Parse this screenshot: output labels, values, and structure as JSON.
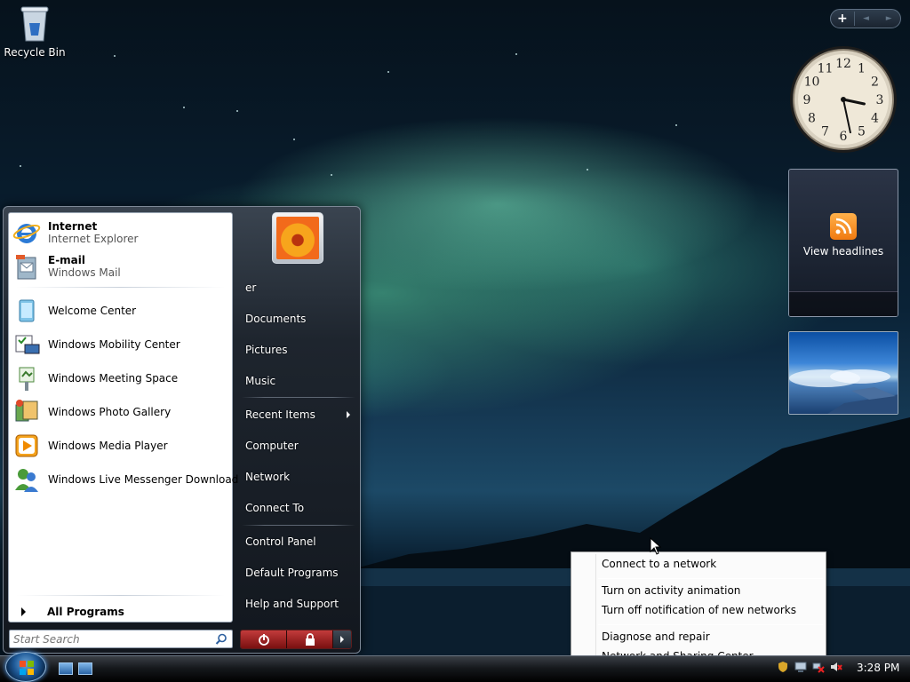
{
  "desktop": {
    "recycle_bin_label": "Recycle Bin"
  },
  "gadgets": {
    "controls": {
      "add": "+",
      "prev": "◄",
      "next": "►"
    },
    "clock": {
      "numbers": [
        "12",
        "1",
        "2",
        "3",
        "4",
        "5",
        "6",
        "7",
        "8",
        "9",
        "10",
        "11"
      ],
      "hour": 3.4,
      "minute": 28
    },
    "feed": {
      "label": "View headlines"
    }
  },
  "start_menu": {
    "pinned": [
      {
        "title": "Internet",
        "subtitle": "Internet Explorer",
        "icon": "internet-explorer-icon"
      },
      {
        "title": "E-mail",
        "subtitle": "Windows Mail",
        "icon": "windows-mail-icon"
      }
    ],
    "recent_programs": [
      {
        "label": "Welcome Center",
        "icon": "welcome-center-icon"
      },
      {
        "label": "Windows Mobility Center",
        "icon": "mobility-center-icon"
      },
      {
        "label": "Windows Meeting Space",
        "icon": "meeting-space-icon"
      },
      {
        "label": "Windows Photo Gallery",
        "icon": "photo-gallery-icon"
      },
      {
        "label": "Windows Media Player",
        "icon": "media-player-icon"
      },
      {
        "label": "Windows Live Messenger Download",
        "icon": "messenger-icon"
      }
    ],
    "all_programs": "All Programs",
    "search_placeholder": "Start Search",
    "right": {
      "user": "er",
      "documents": "Documents",
      "pictures": "Pictures",
      "music": "Music",
      "recent_items": "Recent Items",
      "computer": "Computer",
      "network": "Network",
      "connect_to": "Connect To",
      "control_panel": "Control Panel",
      "default_programs": "Default Programs",
      "help_support": "Help and Support"
    }
  },
  "context_menu": {
    "items": [
      "Connect to a network",
      "Turn on activity animation",
      "Turn off notification of new networks",
      "Diagnose and repair",
      "Network and Sharing Center"
    ]
  },
  "taskbar": {
    "time": "3:28 PM"
  },
  "colors": {
    "accent": "#1f5a98",
    "power_red": "#c23b3b",
    "menu_dark": "#1e252e"
  }
}
